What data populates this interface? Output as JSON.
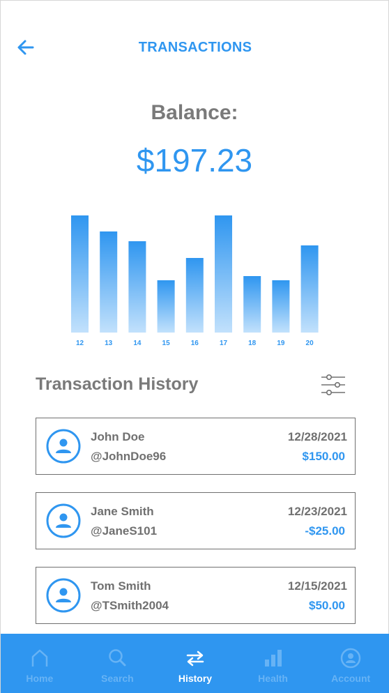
{
  "header": {
    "title": "TRANSACTIONS",
    "back_icon": "arrow-left-icon"
  },
  "balance": {
    "label": "Balance:",
    "value": "$197.23"
  },
  "chart_data": {
    "type": "bar",
    "categories": [
      "12",
      "13",
      "14",
      "15",
      "16",
      "17",
      "18",
      "19",
      "20"
    ],
    "values": [
      168,
      145,
      131,
      75,
      107,
      168,
      81,
      75,
      125
    ],
    "ylim": [
      0,
      168
    ],
    "grid": false,
    "colors": {
      "top": "#2f96f0",
      "bottom": "#c2e1fc"
    }
  },
  "history": {
    "title": "Transaction History",
    "filter_icon": "sliders-icon",
    "transactions": [
      {
        "name": "John Doe",
        "handle": "@JohnDoe96",
        "date": "12/28/2021",
        "amount": "$150.00"
      },
      {
        "name": "Jane Smith",
        "handle": "@JaneS101",
        "date": "12/23/2021",
        "amount": "-$25.00"
      },
      {
        "name": "Tom Smith",
        "handle": "@TSmith2004",
        "date": "12/15/2021",
        "amount": "$50.00"
      }
    ]
  },
  "nav": {
    "items": [
      {
        "label": "Home",
        "icon": "home-icon",
        "active": false
      },
      {
        "label": "Search",
        "icon": "search-icon",
        "active": false
      },
      {
        "label": "History",
        "icon": "swap-arrows-icon",
        "active": true
      },
      {
        "label": "Health",
        "icon": "bar-chart-icon",
        "active": false
      },
      {
        "label": "Account",
        "icon": "user-circle-icon",
        "active": false
      }
    ]
  },
  "colors": {
    "accent": "#2f96f0",
    "text_gray": "#707070",
    "nav_inactive": "#67b3f5",
    "nav_active": "#ffffff"
  }
}
